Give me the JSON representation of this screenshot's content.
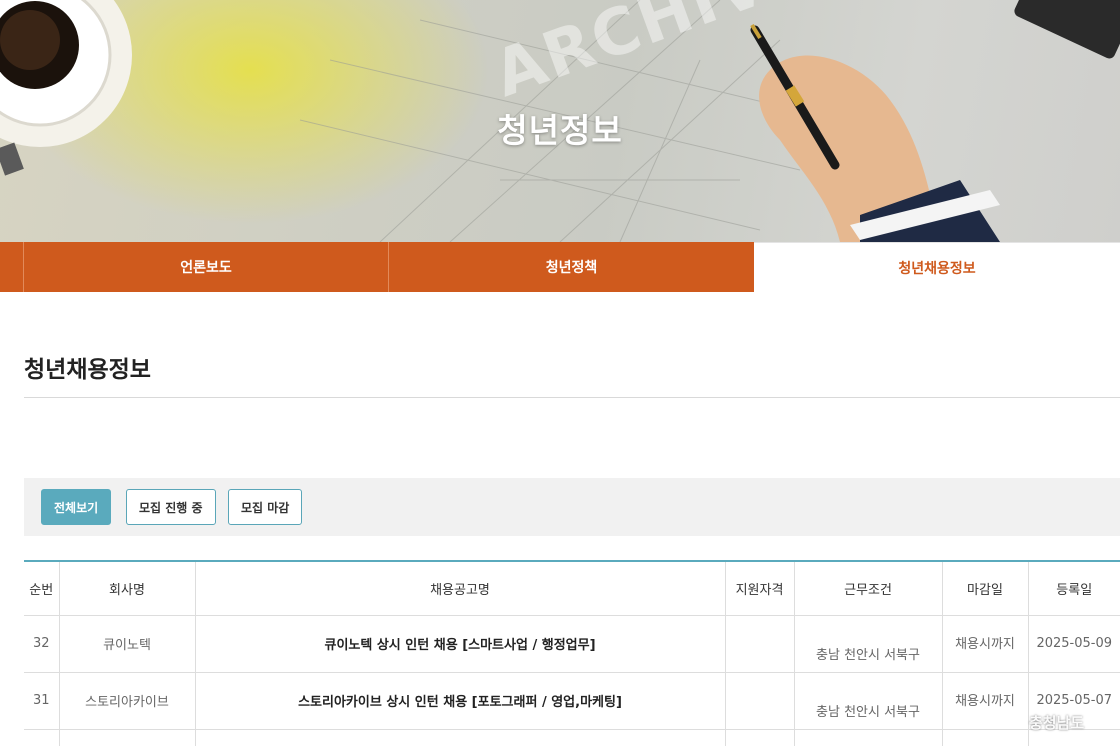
{
  "hero": {
    "title": "청년정보",
    "watermark_word": "ARCHIVE"
  },
  "tabs": [
    {
      "label": "언론보도",
      "active": false
    },
    {
      "label": "청년정책",
      "active": false
    },
    {
      "label": "청년채용정보",
      "active": true
    }
  ],
  "page": {
    "title": "청년채용정보"
  },
  "filters": [
    {
      "label": "전체보기",
      "selected": true
    },
    {
      "label": "모집 진행 중",
      "selected": false
    },
    {
      "label": "모집 마감",
      "selected": false
    }
  ],
  "table": {
    "headers": [
      "순번",
      "회사명",
      "채용공고명",
      "지원자격",
      "근무조건",
      "마감일",
      "등록일"
    ],
    "rows": [
      {
        "no": "32",
        "company": "큐이노텍",
        "title": "큐이노텍 상시 인턴 채용 [스마트사업 / 행정업무]",
        "qualification": "",
        "condition": "충남 천안시 서북구",
        "deadline": "채용시까지",
        "registered": "2025-05-09"
      },
      {
        "no": "31",
        "company": "스토리아카이브",
        "title": "스토리아카이브 상시 인턴 채용 [포토그래퍼 / 영업,마케팅]",
        "qualification": "",
        "condition": "충남 천안시 서북구",
        "deadline": "채용시까지",
        "registered": "2025-05-07"
      }
    ]
  },
  "watermark": {
    "text": "충청남도"
  },
  "colors": {
    "accent_orange": "#cf5a1d",
    "accent_teal": "#5aaabd"
  }
}
